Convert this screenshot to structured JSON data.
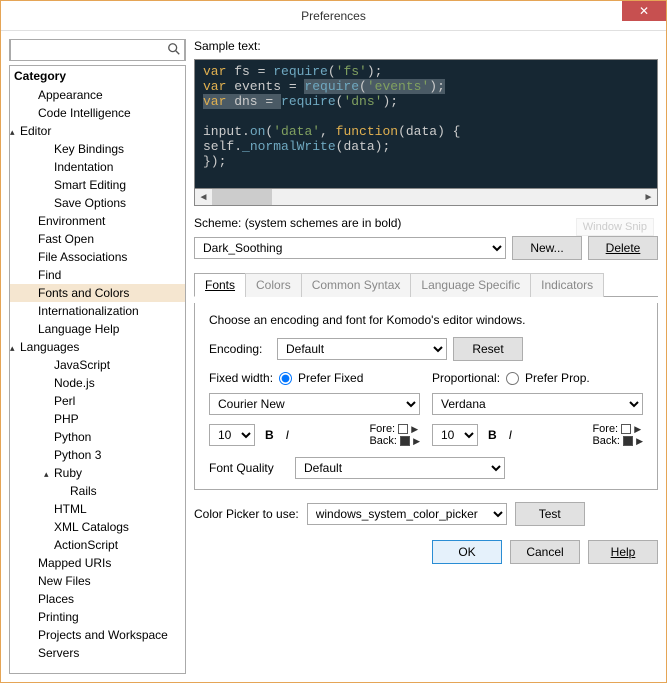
{
  "window": {
    "title": "Preferences"
  },
  "search": {
    "placeholder": ""
  },
  "tree": {
    "header": "Category",
    "items": [
      {
        "label": "Appearance",
        "depth": 1,
        "expand": ""
      },
      {
        "label": "Code Intelligence",
        "depth": 1,
        "expand": ""
      },
      {
        "label": "Editor",
        "depth": 0,
        "expand": "▴"
      },
      {
        "label": "Key Bindings",
        "depth": 2,
        "expand": ""
      },
      {
        "label": "Indentation",
        "depth": 2,
        "expand": ""
      },
      {
        "label": "Smart Editing",
        "depth": 2,
        "expand": ""
      },
      {
        "label": "Save Options",
        "depth": 2,
        "expand": ""
      },
      {
        "label": "Environment",
        "depth": 1,
        "expand": ""
      },
      {
        "label": "Fast Open",
        "depth": 1,
        "expand": ""
      },
      {
        "label": "File Associations",
        "depth": 1,
        "expand": ""
      },
      {
        "label": "Find",
        "depth": 1,
        "expand": ""
      },
      {
        "label": "Fonts and Colors",
        "depth": 1,
        "expand": "",
        "selected": true
      },
      {
        "label": "Internationalization",
        "depth": 1,
        "expand": ""
      },
      {
        "label": "Language Help",
        "depth": 1,
        "expand": ""
      },
      {
        "label": "Languages",
        "depth": 0,
        "expand": "▴"
      },
      {
        "label": "JavaScript",
        "depth": 2,
        "expand": ""
      },
      {
        "label": "Node.js",
        "depth": 2,
        "expand": ""
      },
      {
        "label": "Perl",
        "depth": 2,
        "expand": ""
      },
      {
        "label": "PHP",
        "depth": 2,
        "expand": ""
      },
      {
        "label": "Python",
        "depth": 2,
        "expand": ""
      },
      {
        "label": "Python 3",
        "depth": 2,
        "expand": ""
      },
      {
        "label": "Ruby",
        "depth": 2,
        "expand": "▴"
      },
      {
        "label": "Rails",
        "depth": 3,
        "expand": ""
      },
      {
        "label": "HTML",
        "depth": 2,
        "expand": ""
      },
      {
        "label": "XML Catalogs",
        "depth": 2,
        "expand": ""
      },
      {
        "label": "ActionScript",
        "depth": 2,
        "expand": ""
      },
      {
        "label": "Mapped URIs",
        "depth": 1,
        "expand": ""
      },
      {
        "label": "New Files",
        "depth": 1,
        "expand": ""
      },
      {
        "label": "Places",
        "depth": 1,
        "expand": ""
      },
      {
        "label": "Printing",
        "depth": 1,
        "expand": ""
      },
      {
        "label": "Projects and Workspace",
        "depth": 1,
        "expand": ""
      },
      {
        "label": "Servers",
        "depth": 1,
        "expand": ""
      }
    ]
  },
  "sample": {
    "label": "Sample text:",
    "line1": {
      "a": "var",
      "b": " fs = ",
      "c": "require",
      "d": "(",
      "e": "'fs'",
      "f": ");"
    },
    "line2": {
      "a": "var",
      "b": " events = ",
      "c": "require",
      "d": "(",
      "e": "'events'",
      "f": ");"
    },
    "line3": {
      "a": "var",
      "b": " dns = ",
      "c": "require",
      "d": "(",
      "e": "'dns'",
      "f": ");"
    },
    "line4": {
      "a": "input.",
      "b": "on",
      "c": "(",
      "d": "'data'",
      "e": ", ",
      "f": "function",
      "g": "(data) {"
    },
    "line5": {
      "a": "        self.",
      "b": "_normalWrite",
      "c": "(data);"
    },
    "line6": "    });"
  },
  "scheme": {
    "label": "Scheme: (system schemes are in bold)",
    "value": "Dark_Soothing",
    "new": "New...",
    "delete": "Delete",
    "watermark": "Window Snip"
  },
  "tabs": [
    "Fonts",
    "Colors",
    "Common Syntax",
    "Language Specific",
    "Indicators"
  ],
  "fonts": {
    "intro": "Choose an encoding and font for Komodo's editor windows.",
    "encoding_label": "Encoding:",
    "encoding_value": "Default",
    "reset": "Reset",
    "fixed_label": "Fixed width:",
    "fixed_radio": "Prefer Fixed",
    "fixed_font": "Courier New",
    "fixed_size": "10",
    "prop_label": "Proportional:",
    "prop_radio": "Prefer Prop.",
    "prop_font": "Verdana",
    "prop_size": "10",
    "bold": "B",
    "italic": "I",
    "fore": "Fore:",
    "back": "Back:",
    "quality_label": "Font Quality",
    "quality_value": "Default"
  },
  "color_picker": {
    "label": "Color Picker to use:",
    "value": "windows_system_color_picker",
    "test": "Test"
  },
  "footer": {
    "ok": "OK",
    "cancel": "Cancel",
    "help": "Help"
  }
}
